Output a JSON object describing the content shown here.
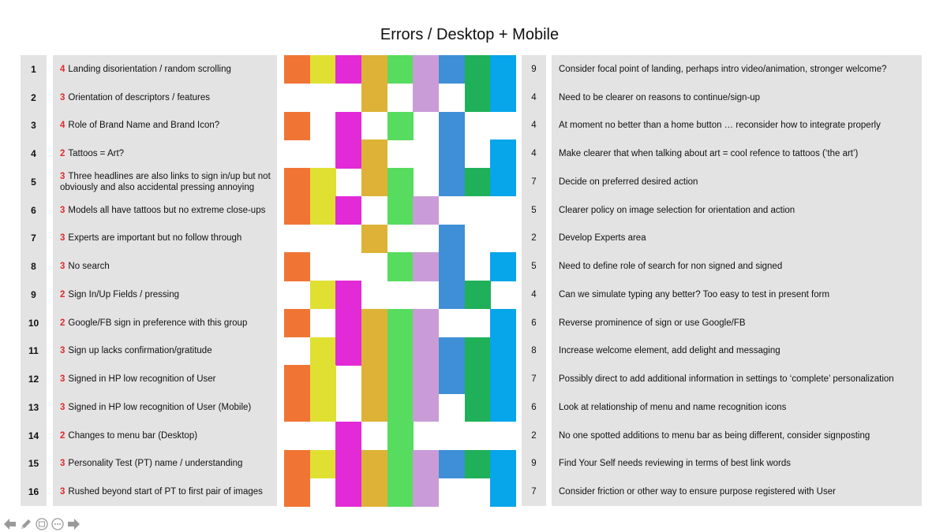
{
  "title": "Errors / Desktop + Mobile",
  "column_colors": [
    "#f07535",
    "#dfe032",
    "#e22ad6",
    "#ddb236",
    "#57dc5f",
    "#c99cd8",
    "#3f8fd6",
    "#20b05a",
    "#07a5ea"
  ],
  "rows": [
    {
      "num": "1",
      "sev": "4",
      "error": "Landing disorientation / random scrolling",
      "score": "9",
      "action": "Consider focal point of landing, perhaps intro video/animation, stronger welcome?",
      "marks": [
        1,
        1,
        1,
        1,
        1,
        1,
        1,
        1,
        1
      ]
    },
    {
      "num": "2",
      "sev": "3",
      "error": "Orientation of descriptors / features",
      "score": "4",
      "action": "Need to be clearer on reasons to continue/sign-up",
      "marks": [
        0,
        0,
        0,
        1,
        0,
        1,
        0,
        1,
        1
      ]
    },
    {
      "num": "3",
      "sev": "4",
      "error": "Role of Brand Name and Brand Icon?",
      "score": "4",
      "action": "At moment no better than a home button … reconsider how to integrate properly",
      "marks": [
        1,
        0,
        1,
        0,
        1,
        0,
        1,
        0,
        0
      ]
    },
    {
      "num": "4",
      "sev": "2",
      "error": "Tattoos = Art?",
      "score": "4",
      "action": "Make clearer that when talking about art = cool refence to tattoos (‘the art’)",
      "marks": [
        0,
        0,
        1,
        1,
        0,
        0,
        1,
        0,
        1
      ]
    },
    {
      "num": "5",
      "sev": "3",
      "error": "Three headlines are also links to sign in/up but not obviously and also accidental pressing annoying",
      "score": "7",
      "action": "Decide on preferred desired action",
      "marks": [
        1,
        1,
        0,
        1,
        1,
        0,
        1,
        1,
        1
      ]
    },
    {
      "num": "6",
      "sev": "3",
      "error": "Models all have tattoos but no extreme close-ups",
      "score": "5",
      "action": "Clearer policy on image selection for orientation and action",
      "marks": [
        1,
        1,
        1,
        0,
        1,
        1,
        0,
        0,
        0
      ]
    },
    {
      "num": "7",
      "sev": "3",
      "error": "Experts are important but no follow through",
      "score": "2",
      "action": "Develop Experts area",
      "marks": [
        0,
        0,
        0,
        1,
        0,
        0,
        1,
        0,
        0
      ]
    },
    {
      "num": "8",
      "sev": "3",
      "error": "No search",
      "score": "5",
      "action": "Need to define role of search for non signed and signed",
      "marks": [
        1,
        0,
        0,
        0,
        1,
        1,
        1,
        0,
        1
      ]
    },
    {
      "num": "9",
      "sev": "2",
      "error": "Sign In/Up Fields / pressing",
      "score": "4",
      "action": "Can we simulate typing any better? Too easy to test in present form",
      "marks": [
        0,
        1,
        1,
        0,
        0,
        0,
        1,
        1,
        0
      ]
    },
    {
      "num": "10",
      "sev": "2",
      "error": "Google/FB sign in preference with this group",
      "score": "6",
      "action": "Reverse prominence of sign or use Google/FB",
      "marks": [
        1,
        0,
        1,
        1,
        1,
        1,
        0,
        0,
        1
      ]
    },
    {
      "num": "11",
      "sev": "3",
      "error": "Sign up lacks confirmation/gratitude",
      "score": "8",
      "action": "Increase welcome element, add delight and messaging",
      "marks": [
        0,
        1,
        1,
        1,
        1,
        1,
        1,
        1,
        1
      ]
    },
    {
      "num": "12",
      "sev": "3",
      "error": "Signed in HP low recognition of User",
      "score": "7",
      "action": "Possibly direct to add additional information in settings to ‘complete’ personalization",
      "marks": [
        1,
        1,
        0,
        1,
        1,
        1,
        1,
        1,
        1
      ]
    },
    {
      "num": "13",
      "sev": "3",
      "error": "Signed in HP low recognition of User (Mobile)",
      "score": "6",
      "action": "Look at relationship of menu and name recognition icons",
      "marks": [
        1,
        1,
        0,
        1,
        1,
        1,
        0,
        1,
        1
      ]
    },
    {
      "num": "14",
      "sev": "2",
      "error": "Changes to menu bar (Desktop)",
      "score": "2",
      "action": "No one spotted additions to menu bar as being different, consider signposting",
      "marks": [
        0,
        0,
        1,
        0,
        1,
        0,
        0,
        0,
        0
      ]
    },
    {
      "num": "15",
      "sev": "3",
      "error": "Personality Test (PT) name / understanding",
      "score": "9",
      "action": "Find Your Self needs reviewing in terms of best link words",
      "marks": [
        1,
        1,
        1,
        1,
        1,
        1,
        1,
        1,
        1
      ]
    },
    {
      "num": "16",
      "sev": "3",
      "error": "Rushed beyond start of PT to first pair of images",
      "score": "7",
      "action": "Consider friction or other way to ensure purpose registered with User",
      "marks": [
        1,
        0,
        1,
        1,
        1,
        1,
        0,
        0,
        1
      ]
    }
  ],
  "toolbar": {
    "icons": [
      "arrow-left-icon",
      "pencil-icon",
      "slides-icon",
      "more-icon",
      "arrow-right-icon"
    ]
  }
}
